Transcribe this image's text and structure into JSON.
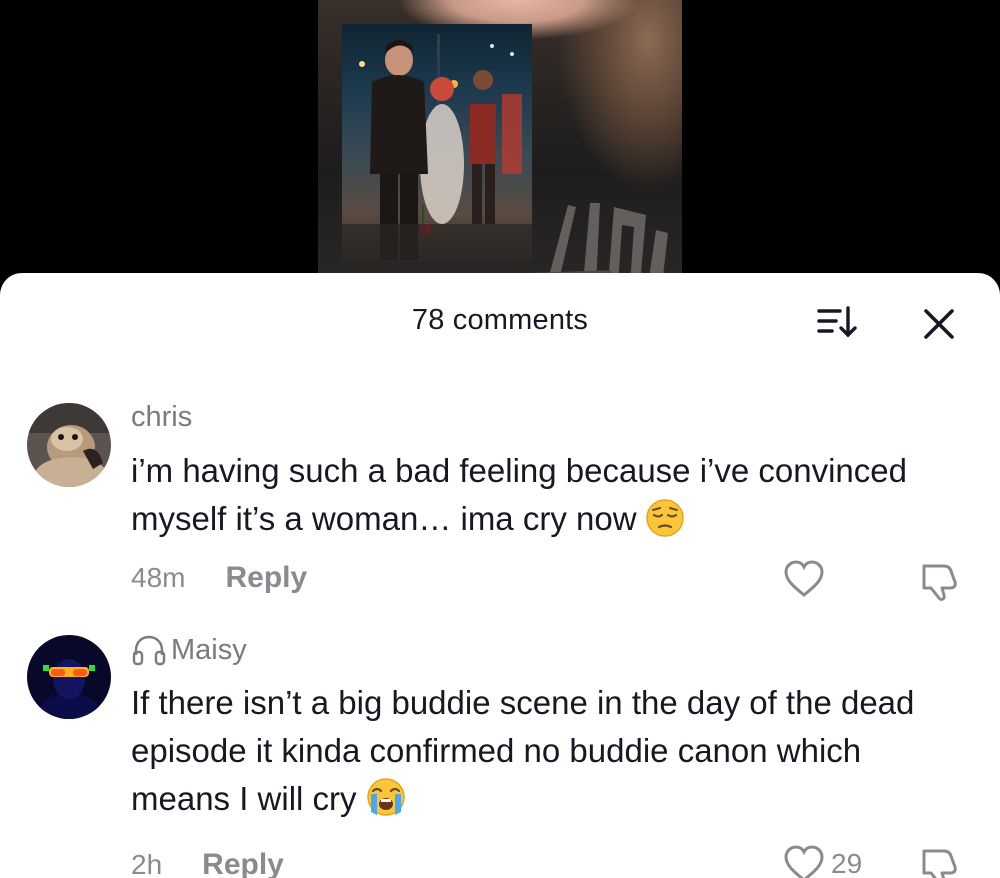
{
  "video": {
    "shirt_text": "DIA"
  },
  "sheet": {
    "comments_count": "78 comments",
    "sort_icon": "sort-icon",
    "close_icon": "close-icon"
  },
  "comments": [
    {
      "username": "chris",
      "text": "i’m having such a bad feeling because i’ve convinced myself it’s a woman… ima cry now",
      "emoji": "pensive-face",
      "time": "48m",
      "reply_label": "Reply",
      "likes": ""
    },
    {
      "username": "Maisy",
      "badge_icon": "headphones-icon",
      "text": "If there isn’t a big buddie scene in the day of the dead episode it kinda confirmed no buddie canon which means I will cry",
      "emoji": "loudly-crying-face",
      "time": "2h",
      "reply_label": "Reply",
      "likes": "29"
    }
  ],
  "colors": {
    "text_primary": "#161823",
    "text_secondary": "#8a8b91",
    "sheet_bg": "#ffffff",
    "video_bg": "#000000"
  }
}
